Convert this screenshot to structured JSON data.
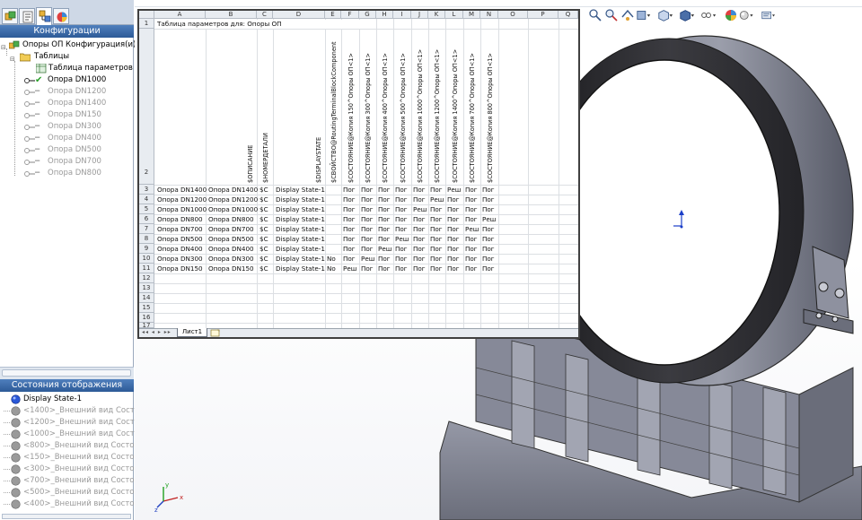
{
  "left_panel": {
    "configurations_header": "Конфигурации",
    "root": "Опоры ОП Конфигурация(и)",
    "tables_folder": "Таблицы",
    "design_table": "Таблица параметров",
    "configurations": [
      {
        "label": "Опора DN1000",
        "active": true
      },
      {
        "label": "Опора DN1200",
        "active": false
      },
      {
        "label": "Опора DN1400",
        "active": false
      },
      {
        "label": "Опора DN150",
        "active": false
      },
      {
        "label": "Опора DN300",
        "active": false
      },
      {
        "label": "Опора DN400",
        "active": false
      },
      {
        "label": "Опора DN500",
        "active": false
      },
      {
        "label": "Опора DN700",
        "active": false
      },
      {
        "label": "Опора DN800",
        "active": false
      }
    ],
    "display_states_header": "Состояния отображения",
    "display_states": [
      {
        "label": "Display State-1",
        "active": true
      },
      {
        "label": "<1400>_Внешний вид Состояни",
        "active": false
      },
      {
        "label": "<1200>_Внешний вид Состояни",
        "active": false
      },
      {
        "label": "<1000>_Внешний вид Состояни",
        "active": false
      },
      {
        "label": "<800>_Внешний вид Состояни",
        "active": false
      },
      {
        "label": "<150>_Внешний вид Состояни",
        "active": false
      },
      {
        "label": "<300>_Внешний вид Состояни",
        "active": false
      },
      {
        "label": "<700>_Внешний вид Состояни",
        "active": false
      },
      {
        "label": "<500>_Внешний вид Состояни",
        "active": false
      },
      {
        "label": "<400>_Внешний вид Состояни",
        "active": false
      }
    ]
  },
  "sheet": {
    "columns": [
      "A",
      "B",
      "C",
      "D",
      "E",
      "F",
      "G",
      "H",
      "I",
      "J",
      "K",
      "L",
      "M",
      "N",
      "O",
      "P",
      "Q"
    ],
    "title_cell": "Таблица параметров для: Опоры ОП",
    "headers": [
      "$ОПИСАНИЕ",
      "$НОМЕРДЕТАЛИ",
      "$DISPLAYSTATE",
      "$СВОЙСТВО@RoutingTerminalBlockComponent",
      "$СОСТОЯНИЕ@Копия 150^Опоры ОП<1>",
      "$СОСТОЯНИЕ@Копия 300^Опоры ОП<1>",
      "$СОСТОЯНИЕ@Копия 400^Опоры ОП<1>",
      "$СОСТОЯНИЕ@Копия 500^Опоры ОП<1>",
      "$СОСТОЯНИЕ@Копия 1000^Опоры ОП<1>",
      "$СОСТОЯНИЕ@Копия 1200^Опоры ОП<1>",
      "$СОСТОЯНИЕ@Копия 1400^Опоры ОП<1>",
      "$СОСТОЯНИЕ@Копия 700^Опоры ОП<1>",
      "$СОСТОЯНИЕ@Копия 800^Опоры ОП<1>"
    ],
    "rows": [
      [
        "Опора DN1400",
        "Опора DN1400",
        "$C",
        "Display State-1",
        "",
        "Пог",
        "Пог",
        "Пог",
        "Пог",
        "Пог",
        "Пог",
        "Реш",
        "Пог",
        "Пог"
      ],
      [
        "Опора DN1200",
        "Опора DN1200",
        "$C",
        "Display State-1",
        "",
        "Пог",
        "Пог",
        "Пог",
        "Пог",
        "Пог",
        "Реш",
        "Пог",
        "Пог",
        "Пог"
      ],
      [
        "Опора DN1000",
        "Опора DN1000",
        "$C",
        "Display State-1",
        "",
        "Пог",
        "Пог",
        "Пог",
        "Пог",
        "Реш",
        "Пог",
        "Пог",
        "Пог",
        "Пог"
      ],
      [
        "Опора DN800",
        "Опора DN800",
        "$C",
        "Display State-1",
        "",
        "Пог",
        "Пог",
        "Пог",
        "Пог",
        "Пог",
        "Пог",
        "Пог",
        "Пог",
        "Реш"
      ],
      [
        "Опора DN700",
        "Опора DN700",
        "$C",
        "Display State-1",
        "",
        "Пог",
        "Пог",
        "Пог",
        "Пог",
        "Пог",
        "Пог",
        "Пог",
        "Реш",
        "Пог"
      ],
      [
        "Опора DN500",
        "Опора DN500",
        "$C",
        "Display State-1",
        "",
        "Пог",
        "Пог",
        "Пог",
        "Реш",
        "Пог",
        "Пог",
        "Пог",
        "Пог",
        "Пог"
      ],
      [
        "Опора DN400",
        "Опора DN400",
        "$C",
        "Display State-1",
        "",
        "Пог",
        "Пог",
        "Реш",
        "Пог",
        "Пог",
        "Пог",
        "Пог",
        "Пог",
        "Пог"
      ],
      [
        "Опора DN300",
        "Опора DN300",
        "$C",
        "Display State-1",
        "No",
        "Пог",
        "Реш",
        "Пог",
        "Пог",
        "Пог",
        "Пог",
        "Пог",
        "Пог",
        "Пог"
      ],
      [
        "Опора DN150",
        "Опора DN150",
        "$C",
        "Display State-1",
        "No",
        "Реш",
        "Пог",
        "Пог",
        "Пог",
        "Пог",
        "Пог",
        "Пог",
        "Пог",
        "Пог"
      ]
    ],
    "row_numbers": [
      "1",
      "2",
      "3",
      "4",
      "5",
      "6",
      "7",
      "8",
      "9",
      "10",
      "11",
      "12",
      "13",
      "14",
      "15",
      "16",
      "17"
    ],
    "sheet_tab": "Лист1",
    "nav_glyphs": "◂◂ ◂ ▸ ▸▸"
  },
  "triad": {
    "x": "x",
    "y": "y",
    "z": "z"
  },
  "colors": {
    "panel_header": "#2d5a97",
    "tab_strip": "#ced8e6",
    "model_gray": "#8c8f9c",
    "model_dark": "#2b2b2e",
    "active_check": "#2aa02a"
  }
}
